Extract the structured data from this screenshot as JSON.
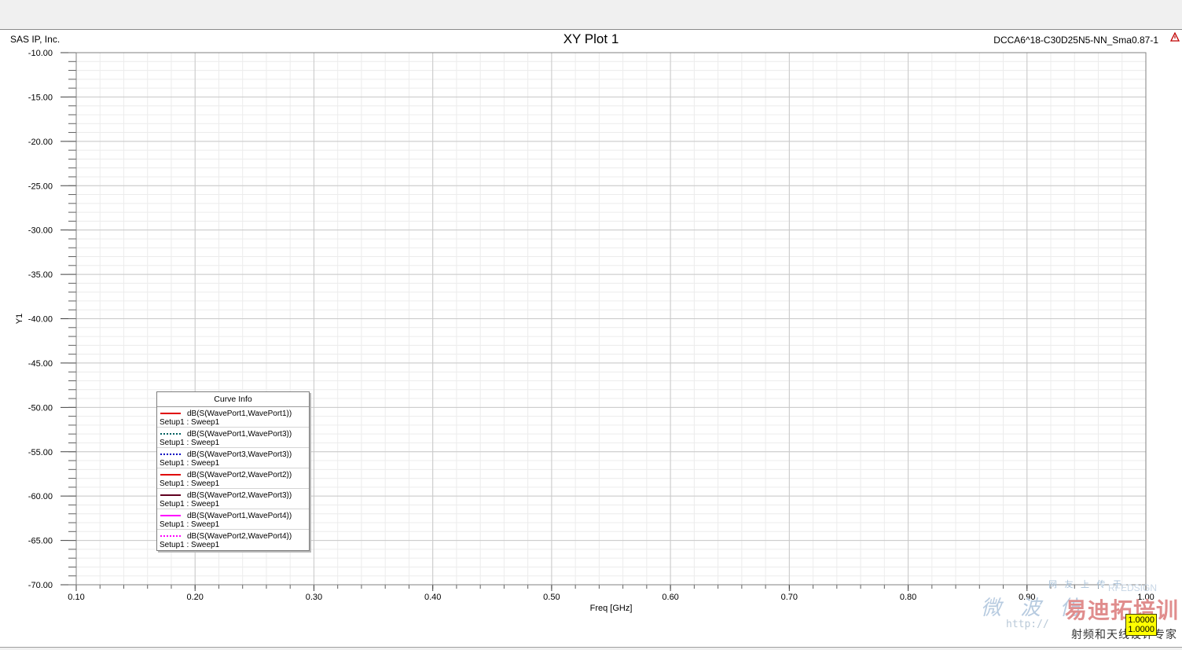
{
  "window": {
    "company": "SAS IP, Inc.",
    "title": "XY Plot 1",
    "design": "DCCA6^18-C30D25N5-NN_Sma0.87-1"
  },
  "icons": {
    "warning": "warning-triangle-icon"
  },
  "legend": {
    "title": "Curve Info",
    "entries": [
      {
        "name": "dB(S(WavePort1,WavePort1))",
        "setup": "Setup1 : Sweep1",
        "color": "#e00000",
        "style": "solid"
      },
      {
        "name": "dB(S(WavePort1,WavePort3))",
        "setup": "Setup1 : Sweep1",
        "color": "#006060",
        "style": "dotted"
      },
      {
        "name": "dB(S(WavePort3,WavePort3))",
        "setup": "Setup1 : Sweep1",
        "color": "#0000c0",
        "style": "dotted"
      },
      {
        "name": "dB(S(WavePort2,WavePort2))",
        "setup": "Setup1 : Sweep1",
        "color": "#e00000",
        "style": "solid"
      },
      {
        "name": "dB(S(WavePort2,WavePort3))",
        "setup": "Setup1 : Sweep1",
        "color": "#600020",
        "style": "solid"
      },
      {
        "name": "dB(S(WavePort1,WavePort4))",
        "setup": "Setup1 : Sweep1",
        "color": "#ff00ff",
        "style": "solid"
      },
      {
        "name": "dB(S(WavePort2,WavePort4))",
        "setup": "Setup1 : Sweep1",
        "color": "#ff00ff",
        "style": "dotted"
      }
    ]
  },
  "watermark": {
    "top": "网 友 上 传 于",
    "rfedsign": "RFEDSIGN",
    "cn1": "微 波 仿",
    "cn2": "易迪拓培训",
    "url": "http://",
    "cn3": "射频和天线设计专家",
    "marker": [
      "1.0000",
      "1.0000"
    ]
  },
  "chart_data": {
    "type": "line",
    "title": "XY Plot 1",
    "xlabel": "Freq [GHz]",
    "ylabel": "Y1",
    "xlim": [
      0.1,
      1.0
    ],
    "ylim": [
      -70,
      -10
    ],
    "xticks": [
      0.1,
      0.2,
      0.3,
      0.4,
      0.5,
      0.6,
      0.7,
      0.8,
      0.9,
      1.0
    ],
    "xtick_labels": [
      "0.10",
      "0.20",
      "0.30",
      "0.40",
      "0.50",
      "0.60",
      "0.70",
      "0.80",
      "0.90",
      "1.00"
    ],
    "yticks": [
      -10,
      -15,
      -20,
      -25,
      -30,
      -35,
      -40,
      -45,
      -50,
      -55,
      -60,
      -65,
      -70
    ],
    "ytick_labels": [
      "-10.00",
      "-15.00",
      "-20.00",
      "-25.00",
      "-30.00",
      "-35.00",
      "-40.00",
      "-45.00",
      "-50.00",
      "-55.00",
      "-60.00",
      "-65.00",
      "-70.00"
    ],
    "grid": true,
    "legend_position": "bottom-left",
    "series": [
      {
        "name": "dB(S(WavePort1,WavePort1))",
        "values": []
      },
      {
        "name": "dB(S(WavePort1,WavePort3))",
        "values": []
      },
      {
        "name": "dB(S(WavePort3,WavePort3))",
        "values": []
      },
      {
        "name": "dB(S(WavePort2,WavePort2))",
        "values": []
      },
      {
        "name": "dB(S(WavePort2,WavePort3))",
        "values": []
      },
      {
        "name": "dB(S(WavePort1,WavePort4))",
        "values": []
      },
      {
        "name": "dB(S(WavePort2,WavePort4))",
        "values": []
      }
    ]
  }
}
